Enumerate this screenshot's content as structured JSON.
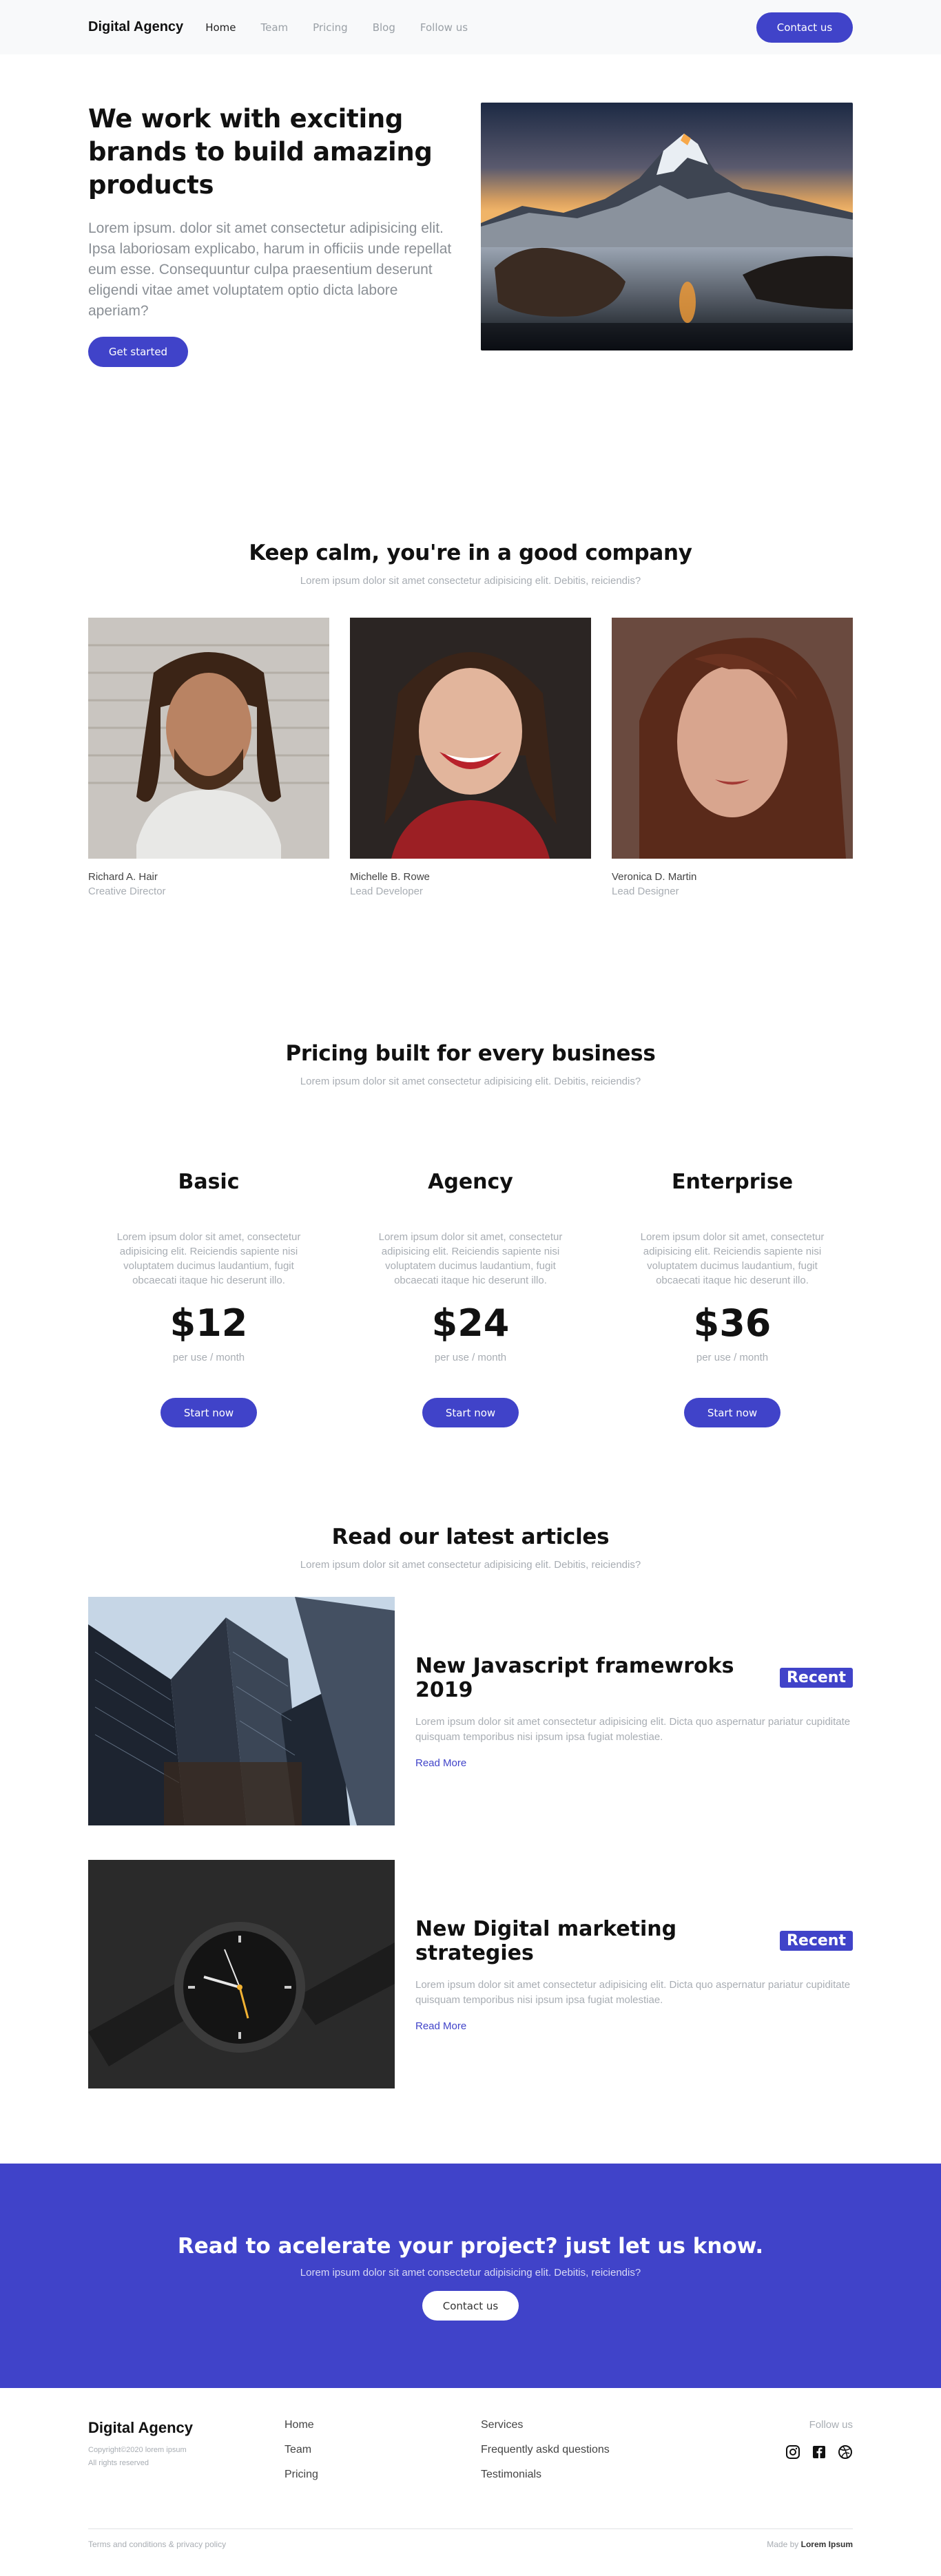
{
  "header": {
    "brand": "Digital Agency",
    "nav": [
      "Home",
      "Team",
      "Pricing",
      "Blog",
      "Follow us"
    ],
    "cta": "Contact us"
  },
  "hero": {
    "title": "We work with exciting brands to build amazing products",
    "subtitle": "Lorem ipsum. dolor sit amet consectetur adipisicing elit. Ipsa laboriosam explicabo, harum in officiis unde repellat eum esse. Consequuntur culpa praesentium deserunt eligendi vitae amet voluptatem optio dicta labore aperiam?",
    "cta": "Get started"
  },
  "team": {
    "title": "Keep calm, you're in a good company",
    "subtitle": "Lorem ipsum dolor sit amet consectetur adipisicing elit. Debitis, reiciendis?",
    "members": [
      {
        "name": "Richard A. Hair",
        "role": "Creative Director"
      },
      {
        "name": "Michelle B. Rowe",
        "role": "Lead Developer"
      },
      {
        "name": "Veronica D. Martin",
        "role": "Lead Designer"
      }
    ]
  },
  "pricing": {
    "title": "Pricing built for every business",
    "subtitle": "Lorem ipsum dolor sit amet consectetur adipisicing elit. Debitis, reiciendis?",
    "plans": [
      {
        "name": "Basic",
        "desc": "Lorem ipsum dolor sit amet, consectetur adipisicing elit. Reiciendis sapiente nisi voluptatem ducimus laudantium, fugit obcaecati itaque hic deserunt illo.",
        "price": "$12",
        "per": "per use / month",
        "cta": "Start now"
      },
      {
        "name": "Agency",
        "desc": "Lorem ipsum dolor sit amet, consectetur adipisicing elit. Reiciendis sapiente nisi voluptatem ducimus laudantium, fugit obcaecati itaque hic deserunt illo.",
        "price": "$24",
        "per": "per use / month",
        "cta": "Start now"
      },
      {
        "name": "Enterprise",
        "desc": "Lorem ipsum dolor sit amet, consectetur adipisicing elit. Reiciendis sapiente nisi voluptatem ducimus laudantium, fugit obcaecati itaque hic deserunt illo.",
        "price": "$36",
        "per": "per use / month",
        "cta": "Start now"
      }
    ]
  },
  "articles": {
    "title": "Read our latest articles",
    "subtitle": "Lorem ipsum dolor sit amet consectetur adipisicing elit. Debitis, reiciendis?",
    "items": [
      {
        "title": "New Javascript framewroks 2019",
        "badge": "Recent",
        "text": "Lorem ipsum dolor sit amet consectetur adipisicing elit. Dicta quo aspernatur pariatur cupiditate quisquam temporibus nisi ipsum ipsa fugiat molestiae.",
        "link": "Read More"
      },
      {
        "title": "New Digital marketing strategies",
        "badge": "Recent",
        "text": "Lorem ipsum dolor sit amet consectetur adipisicing elit. Dicta quo aspernatur pariatur cupiditate quisquam temporibus nisi ipsum ipsa fugiat molestiae.",
        "link": "Read More"
      }
    ]
  },
  "cta_band": {
    "title": "Read to acelerate your project? just let us know.",
    "subtitle": "Lorem ipsum dolor sit amet consectetur adipisicing elit. Debitis, reiciendis?",
    "button": "Contact us"
  },
  "footer": {
    "brand": "Digital Agency",
    "copyright": "Copyright©2020 lorem ipsum",
    "rights": "All rights reserved",
    "col1": [
      "Home",
      "Team",
      "Pricing"
    ],
    "col2": [
      "Services",
      "Frequently askd questions",
      "Testimonials"
    ],
    "follow": "Follow us",
    "social_icons": [
      "instagram-icon",
      "facebook-icon",
      "dribbble-icon"
    ],
    "terms": "Terms and conditions & privacy policy",
    "made_by_prefix": "Made by",
    "made_by_name": "Lorem Ipsum"
  },
  "colors": {
    "accent": "#4043c9",
    "muted": "#a8adb3",
    "nav_bg": "#f8f9fa"
  }
}
